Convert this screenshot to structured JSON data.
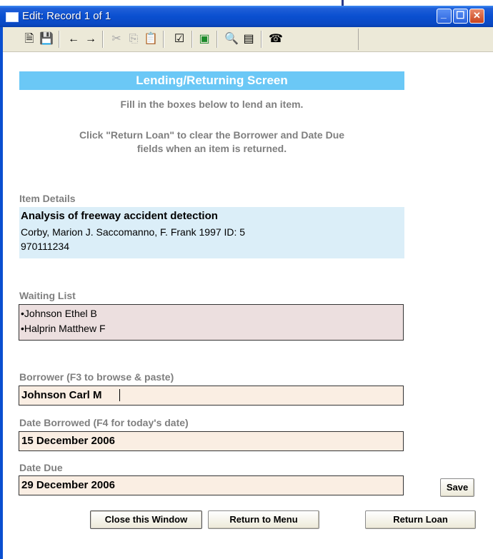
{
  "window": {
    "title": "Edit: Record 1 of 1",
    "controls": {
      "minimize_glyph": "_",
      "maximize_glyph": "☐",
      "close_glyph": "✕"
    }
  },
  "toolbar": {
    "icons": [
      {
        "name": "new-record-icon",
        "glyph": "🗎",
        "enabled": true
      },
      {
        "name": "save-icon",
        "glyph": "💾",
        "enabled": true
      },
      {
        "name": "previous-arrow-icon",
        "glyph": "←",
        "enabled": true
      },
      {
        "name": "next-arrow-icon",
        "glyph": "→",
        "enabled": true
      },
      {
        "name": "cut-icon",
        "glyph": "✂",
        "enabled": false
      },
      {
        "name": "copy-icon",
        "glyph": "⎘",
        "enabled": false
      },
      {
        "name": "paste-icon",
        "glyph": "📋",
        "enabled": false
      },
      {
        "name": "spellcheck-icon",
        "glyph": "☑",
        "enabled": true
      },
      {
        "name": "image-icon",
        "glyph": "▣",
        "enabled": true
      },
      {
        "name": "find-icon",
        "glyph": "🔍",
        "enabled": true
      },
      {
        "name": "form-view-icon",
        "glyph": "▤",
        "enabled": true
      },
      {
        "name": "phone-icon",
        "glyph": "☎",
        "enabled": true
      }
    ]
  },
  "form": {
    "header": "Lending/Returning Screen",
    "instruction1": "Fill in the boxes below to lend an item.",
    "instruction2_line1": "Click \"Return Loan\" to clear the Borrower and Date Due",
    "instruction2_line2": "fields when an item is returned.",
    "item_details": {
      "label": "Item Details",
      "title": "Analysis of freeway accident detection",
      "line1": "Corby, Marion J. Saccomanno, F. Frank 1997 ID: 5",
      "line2": "970111234"
    },
    "waiting_list": {
      "label": "Waiting List",
      "items": [
        "•Johnson Ethel B",
        "•Halprin Matthew F"
      ]
    },
    "borrower": {
      "label": "Borrower (F3 to browse & paste)",
      "value": "Johnson Carl M"
    },
    "date_borrowed": {
      "label": "Date Borrowed (F4 for today's date)",
      "value": "15 December 2006"
    },
    "date_due": {
      "label": "Date Due",
      "value": "29 December 2006"
    }
  },
  "buttons": {
    "save": "Save",
    "close": "Close this Window",
    "menu": "Return to Menu",
    "return_loan": "Return Loan"
  },
  "colors": {
    "title_bar": "#0a4fd0",
    "header_bg": "#6bc8f6",
    "item_bg": "#dbeef8",
    "waiting_bg": "#ecdfdf",
    "field_bg": "#faeee3",
    "label_gray": "#7f7f7f"
  }
}
